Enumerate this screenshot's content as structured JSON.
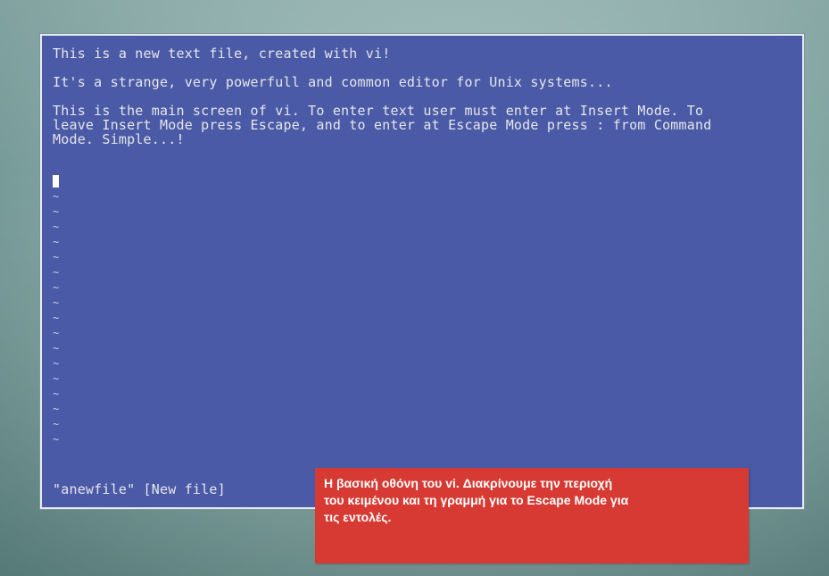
{
  "editor": {
    "lines": [
      "This is a new text file, created with vi!",
      "",
      "It's a strange, very powerfull and common editor for Unix systems...",
      "",
      "This is the main screen of vi. To enter text user must enter at Insert Mode. To",
      "leave Insert Mode press Escape, and to enter at Escape Mode press : from Command",
      "Mode. Simple...!"
    ],
    "empty_line_marker": "~",
    "status_line": "\"anewfile\" [New file]"
  },
  "caption": {
    "lines": [
      "Η βασική οθόνη του vi. Διακρίνουμε την περιοχή",
      "του κειμένου και τη γραμμή για το Escape Mode για",
      "τις εντολές."
    ]
  }
}
